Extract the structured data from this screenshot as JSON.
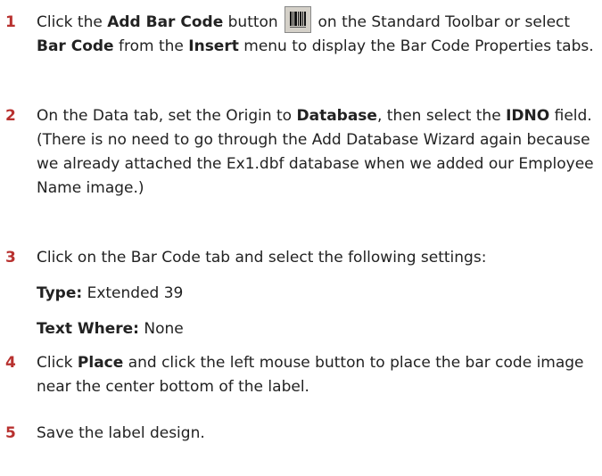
{
  "steps": [
    {
      "number": "1",
      "parts": {
        "t1": "Click the ",
        "b1": "Add Bar Code",
        "t2": " button ",
        "t3": " on the Standard Toolbar or select ",
        "b2": "Bar Code",
        "t4": " from the ",
        "b3": "Insert",
        "t5": " menu to display the Bar Code Properties tabs."
      },
      "icon": "barcode-icon"
    },
    {
      "number": "2",
      "parts": {
        "t1": "On the Data tab, set the Origin to ",
        "b1": "Database",
        "t2": ", then select the ",
        "b2": "IDNO",
        "t3": " field. (There is no need to go through the Add Database Wizard again because we already attached the Ex1.dbf database when we added our Employee Name image.)"
      }
    },
    {
      "number": "3",
      "text": "Click on the Bar Code tab and select the following settings:",
      "settings": [
        {
          "label": "Type:",
          "value": " Extended 39"
        },
        {
          "label": "Text Where:",
          "value": " None"
        }
      ]
    },
    {
      "number": "4",
      "parts": {
        "t1": "Click ",
        "b1": "Place",
        "t2": " and click the left mouse button to place the bar code image near the center bottom of the label."
      }
    },
    {
      "number": "5",
      "text": "Save the label design."
    }
  ],
  "colors": {
    "step_number": "#b8312f",
    "text": "#222222"
  }
}
